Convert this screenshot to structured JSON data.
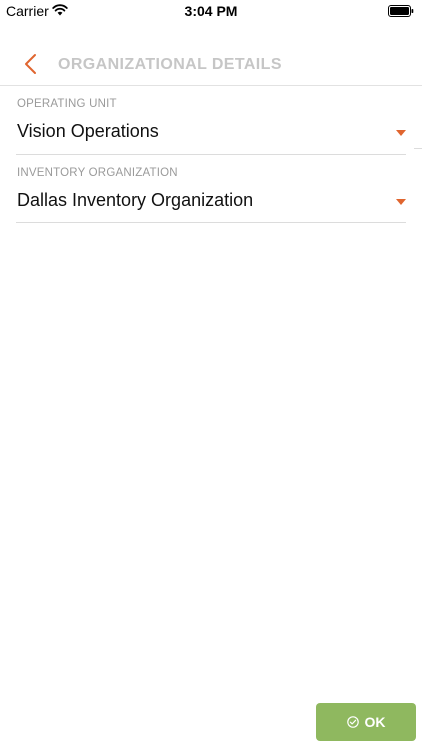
{
  "status_bar": {
    "carrier": "Carrier",
    "time": "3:04 PM"
  },
  "header": {
    "title": "ORGANIZATIONAL DETAILS"
  },
  "fields": {
    "operating_unit": {
      "label": "OPERATING UNIT",
      "value": "Vision Operations"
    },
    "inventory_organization": {
      "label": "INVENTORY ORGANIZATION",
      "value": "Dallas Inventory Organization"
    }
  },
  "actions": {
    "ok_label": "OK"
  },
  "colors": {
    "accent": "#e0652f",
    "ok_button": "#8fb85f",
    "title": "#c6c6c6",
    "label": "#9a9a9a"
  }
}
